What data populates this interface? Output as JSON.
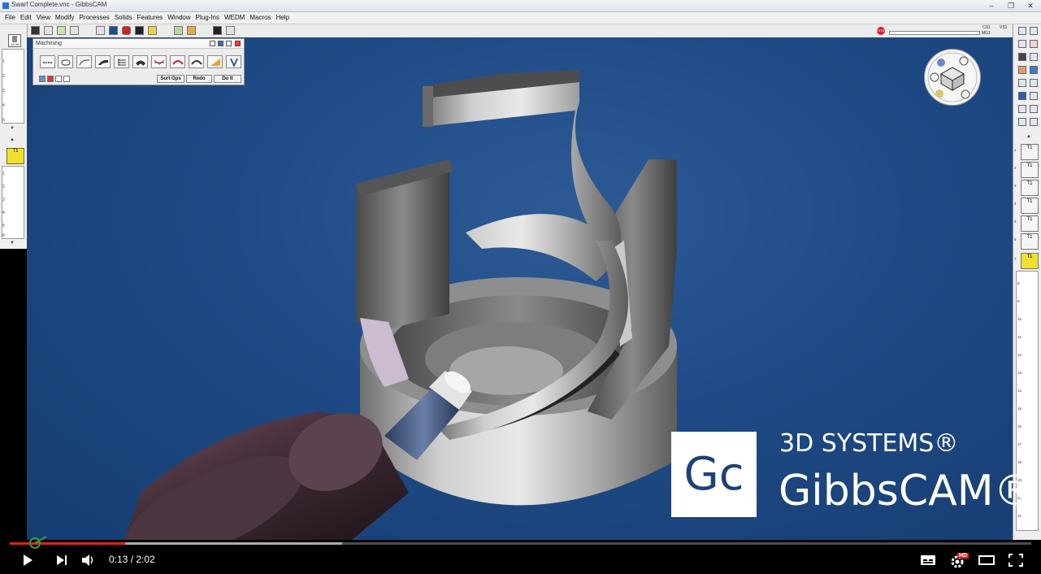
{
  "window": {
    "title": "Swarf Complete.vnc - GibbsCAM",
    "controls": [
      "–",
      "❐",
      "✕"
    ]
  },
  "menu": [
    "File",
    "Edit",
    "View",
    "Modify",
    "Processes",
    "Solids",
    "Features",
    "Window",
    "Plug-Ins",
    "WEDM",
    "Macros",
    "Help"
  ],
  "status": {
    "stop_label": "STOP",
    "cs": "CS1",
    "mg": "MG1",
    "vs": "VS1"
  },
  "left_panel": {
    "count_label": "12.00",
    "op_label": "T1",
    "ruler_ticks_top": [
      "1",
      "2",
      "3",
      "4",
      "5"
    ],
    "ruler_ticks_bottom": [
      "1",
      "2",
      "3",
      "4",
      "5",
      "6"
    ]
  },
  "machining": {
    "title": "Machining",
    "sort_ops": "Sort Ops",
    "redo": "Redo",
    "do_it": "Do It"
  },
  "right_panel": {
    "ops": [
      "T1",
      "T1",
      "T1",
      "T1",
      "T1",
      "T1",
      "T1"
    ],
    "op_numbers": [
      "1",
      "2",
      "3",
      "4",
      "5",
      "6",
      "7"
    ],
    "ruler_numbers": [
      "8",
      "9",
      "10",
      "11",
      "12",
      "13",
      "14",
      "15",
      "16",
      "17",
      "18",
      "19",
      "20",
      "21"
    ]
  },
  "branding": {
    "box_text": "Gc",
    "line1": "3D SYSTEMS®",
    "line2": "GibbsCAM®"
  },
  "player": {
    "time": "0:13 / 2:02",
    "progress_played": 0.113,
    "progress_buffered": 0.325,
    "hd_badge": "HD"
  },
  "colors": {
    "viewport_bg": "#1f4a85",
    "progress_red": "#e52117",
    "active_op": "#f0e030",
    "brand_blue": "#1d4279"
  }
}
